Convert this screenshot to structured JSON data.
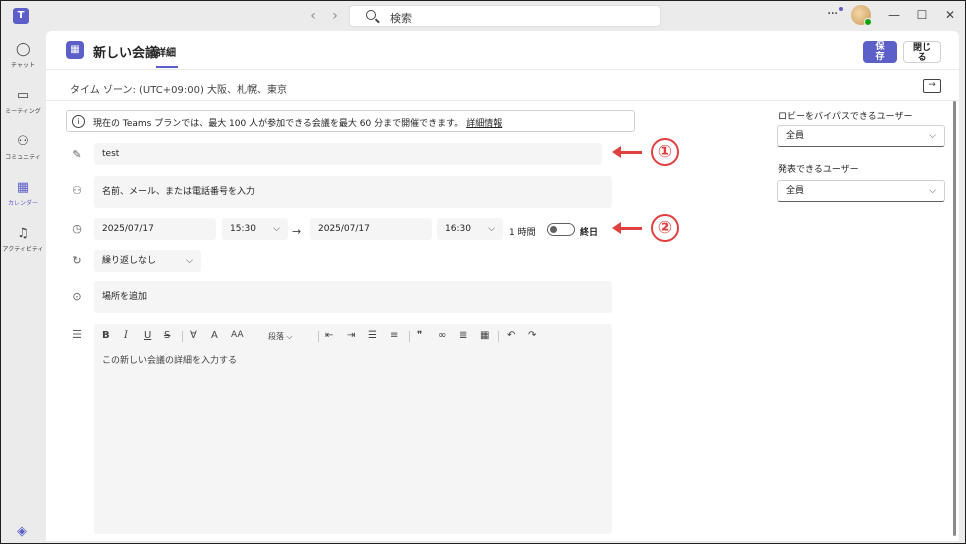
{
  "titlebar": {
    "app_logo": "T",
    "back_icon": "‹",
    "forward_icon": "›",
    "search_placeholder": "検索",
    "more_icon": "···",
    "minimize_icon": "—",
    "maximize_icon": "☐",
    "close_icon": "✕"
  },
  "rail": {
    "items": [
      {
        "label": "チャット",
        "icon": "chat-icon",
        "glyph": "◯"
      },
      {
        "label": "ミーティング",
        "icon": "video-icon",
        "glyph": "▭"
      },
      {
        "label": "コミュニティ",
        "icon": "community-icon",
        "glyph": "⚇"
      },
      {
        "label": "カレンダー",
        "icon": "calendar-icon",
        "glyph": "▦"
      },
      {
        "label": "アクティビティ",
        "icon": "bell-icon",
        "glyph": "♫"
      }
    ],
    "bottom_icon": "◈"
  },
  "header": {
    "title": "新しい会議",
    "tab": "詳細",
    "save_label": "保\n存",
    "close_label": "閉じ\nる"
  },
  "timezone": {
    "label": "タイム ゾーン: (UTC+09:00) 大阪、札幌、東京",
    "chevron": "⌵"
  },
  "info_banner": {
    "text": "現在の Teams プランでは、最大 100 人が参加できる会議を最大 60 分まで開催できます。",
    "link": "詳細情報"
  },
  "form": {
    "title_value": "test",
    "attendees_placeholder": "名前、メール、または電話番号を入力",
    "start_date": "2025/07/17",
    "start_time": "15:30",
    "end_date": "2025/07/17",
    "end_time": "16:30",
    "duration": "1 時間",
    "all_day_label": "終日",
    "repeat_value": "繰り返しなし",
    "location_placeholder": "場所を追加",
    "editor_placeholder": "この新しい会議の詳細を入力する",
    "arrow_glyph": "→"
  },
  "toolbar": {
    "bold": "B",
    "italic": "I",
    "underline": "U",
    "strike": "S",
    "paragraph": "段落",
    "quote": "❞"
  },
  "callouts": {
    "one": "1",
    "two": "2"
  },
  "side": {
    "lobby_label": "ロビーをバイパスできるユーザー",
    "lobby_value": "全員",
    "presenters_label": "発表できるユーザー",
    "presenters_value": "全員"
  },
  "colors": {
    "accent": "#5b5fc7",
    "callout": "#e04040"
  }
}
